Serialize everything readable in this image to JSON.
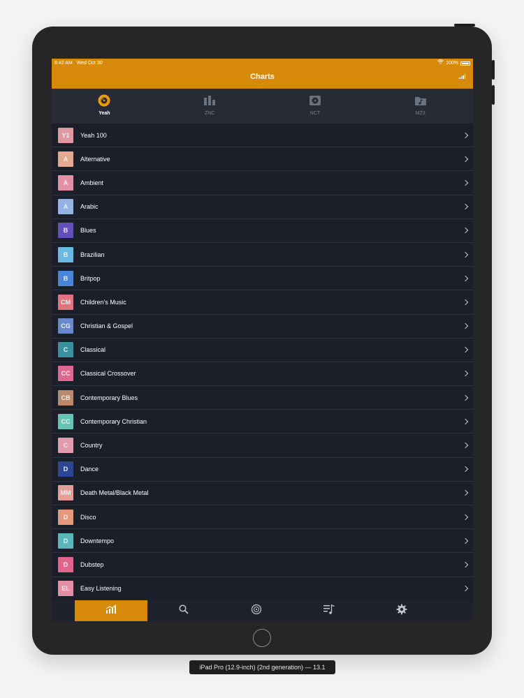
{
  "status_bar": {
    "time": "8:42 AM",
    "date": "Wed Oct 30",
    "battery": "100%"
  },
  "header": {
    "title": "Charts"
  },
  "tabs": [
    {
      "label": "Yeah",
      "active": true,
      "icon": "record-disc-icon"
    },
    {
      "label": "ZNC",
      "active": false,
      "icon": "bar-chart-icon"
    },
    {
      "label": "NCT",
      "active": false,
      "icon": "album-icon"
    },
    {
      "label": "MZ3",
      "active": false,
      "icon": "music-folder-icon"
    }
  ],
  "list": [
    {
      "badge": "Y1",
      "label": "Yeah 100",
      "color": "#f0a2ab"
    },
    {
      "badge": "A",
      "label": "Alternative",
      "color": "#f6b69a"
    },
    {
      "badge": "A",
      "label": "Ambient",
      "color": "#f39ab3"
    },
    {
      "badge": "A",
      "label": "Arabic",
      "color": "#9fc0f4"
    },
    {
      "badge": "B",
      "label": "Blues",
      "color": "#6a55c8"
    },
    {
      "badge": "B",
      "label": "Brazilian",
      "color": "#72c7f3"
    },
    {
      "badge": "B",
      "label": "Britpop",
      "color": "#4f8ee6"
    },
    {
      "badge": "CM",
      "label": "Children's Music",
      "color": "#f07b86"
    },
    {
      "badge": "CG",
      "label": "Christian & Gospel",
      "color": "#6f93d8"
    },
    {
      "badge": "C",
      "label": "Classical",
      "color": "#3c9aa8"
    },
    {
      "badge": "CC",
      "label": "Classical Crossover",
      "color": "#f06f9a"
    },
    {
      "badge": "CB",
      "label": "Contemporary Blues",
      "color": "#c99272"
    },
    {
      "badge": "CC",
      "label": "Contemporary Christian",
      "color": "#6dd2c0"
    },
    {
      "badge": "C",
      "label": "Country",
      "color": "#f3a6b8"
    },
    {
      "badge": "D",
      "label": "Dance",
      "color": "#2f4a9c"
    },
    {
      "badge": "MM",
      "label": "Death Metal/Black Metal",
      "color": "#f7a8a2"
    },
    {
      "badge": "D",
      "label": "Disco",
      "color": "#f6a481"
    },
    {
      "badge": "D",
      "label": "Downtempo",
      "color": "#5fc3c8"
    },
    {
      "badge": "D",
      "label": "Dubstep",
      "color": "#f06b95"
    },
    {
      "badge": "EL",
      "label": "Easy Listening",
      "color": "#f59ab0"
    }
  ],
  "bottom_bar": [
    {
      "icon": "chart-icon",
      "active": true
    },
    {
      "icon": "search-icon",
      "active": false
    },
    {
      "icon": "disc-icon",
      "active": false
    },
    {
      "icon": "playlist-icon",
      "active": false
    },
    {
      "icon": "gear-icon",
      "active": false
    }
  ],
  "caption": "iPad Pro (12.9-inch) (2nd generation) — 13.1",
  "colors": {
    "accent": "#d78a0a",
    "background": "#1b1f2a",
    "tab_bar": "#262b36"
  }
}
